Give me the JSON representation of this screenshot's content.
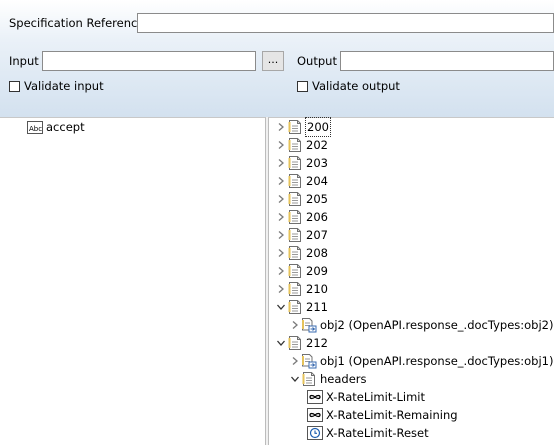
{
  "form": {
    "spec_ref_label": "Specification Reference",
    "spec_ref_value": "",
    "input_label": "Input",
    "input_value": "",
    "browse_label": "...",
    "output_label": "Output",
    "output_value": "",
    "validate_input_label": "Validate input",
    "validate_input_checked": false,
    "validate_output_label": "Validate output",
    "validate_output_checked": false
  },
  "left_tree": {
    "items": [
      {
        "label": "accept",
        "icon": "text-type-icon"
      }
    ]
  },
  "right_tree": {
    "items": [
      {
        "label": "200",
        "icon": "document-icon",
        "expanded": false
      },
      {
        "label": "202",
        "icon": "document-icon",
        "expanded": false
      },
      {
        "label": "203",
        "icon": "document-icon",
        "expanded": false
      },
      {
        "label": "204",
        "icon": "document-icon",
        "expanded": false
      },
      {
        "label": "205",
        "icon": "document-icon",
        "expanded": false
      },
      {
        "label": "206",
        "icon": "document-icon",
        "expanded": false
      },
      {
        "label": "207",
        "icon": "document-icon",
        "expanded": false
      },
      {
        "label": "208",
        "icon": "document-icon",
        "expanded": false
      },
      {
        "label": "209",
        "icon": "document-icon",
        "expanded": false
      },
      {
        "label": "210",
        "icon": "document-icon",
        "expanded": false
      },
      {
        "label": "211",
        "icon": "document-icon",
        "expanded": true
      },
      {
        "label": "obj2 (OpenAPI.response_.docTypes:obj2)",
        "icon": "doctype-ref-icon",
        "expanded": false
      },
      {
        "label": "212",
        "icon": "document-icon",
        "expanded": true
      },
      {
        "label": "obj1 (OpenAPI.response_.docTypes:obj1)",
        "icon": "doctype-ref-icon",
        "expanded": false
      },
      {
        "label": "headers",
        "icon": "document-icon",
        "expanded": true
      },
      {
        "label": "X-RateLimit-Limit",
        "icon": "infinity-icon"
      },
      {
        "label": "X-RateLimit-Remaining",
        "icon": "infinity-icon"
      },
      {
        "label": "X-RateLimit-Reset",
        "icon": "clock-icon"
      }
    ]
  }
}
